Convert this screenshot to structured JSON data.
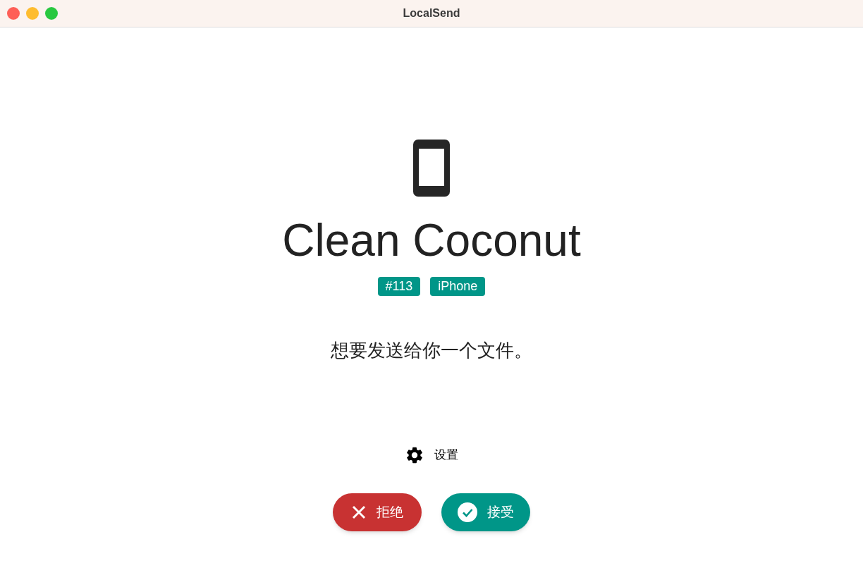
{
  "window": {
    "title": "LocalSend"
  },
  "device": {
    "name": "Clean Coconut",
    "tags": [
      "#113",
      "iPhone"
    ]
  },
  "message": "想要发送给你一个文件。",
  "settings_link": "设置",
  "buttons": [
    {
      "kind": "reject",
      "label": "拒绝"
    },
    {
      "kind": "accept",
      "label": "接受"
    }
  ]
}
